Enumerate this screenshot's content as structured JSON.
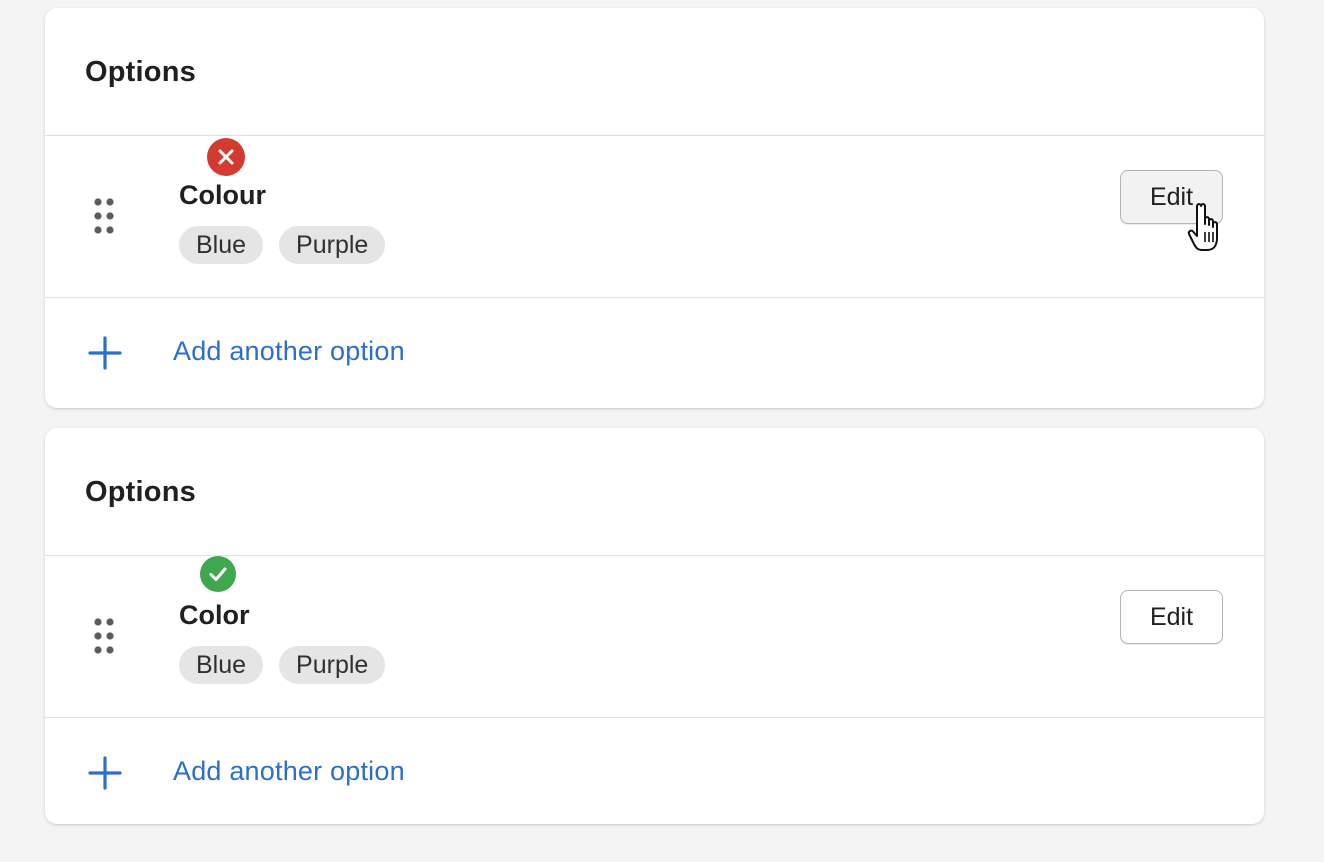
{
  "cards": [
    {
      "title": "Options",
      "option": {
        "name": "Colour",
        "status": "error",
        "values": [
          "Blue",
          "Purple"
        ],
        "edit_label": "Edit"
      },
      "add_label": "Add another option"
    },
    {
      "title": "Options",
      "option": {
        "name": "Color",
        "status": "success",
        "values": [
          "Blue",
          "Purple"
        ],
        "edit_label": "Edit"
      },
      "add_label": "Add another option"
    }
  ],
  "colors": {
    "error": "#d43b30",
    "success": "#3fa84f",
    "link": "#2c6ecb",
    "tag_bg": "#e5e5e5",
    "page_bg": "#f4f4f4"
  },
  "icons": {
    "status_error": "x-circle-icon",
    "status_success": "check-circle-icon",
    "drag": "drag-handle-icon",
    "add": "plus-icon",
    "pointer": "hand-pointer-cursor-icon"
  }
}
